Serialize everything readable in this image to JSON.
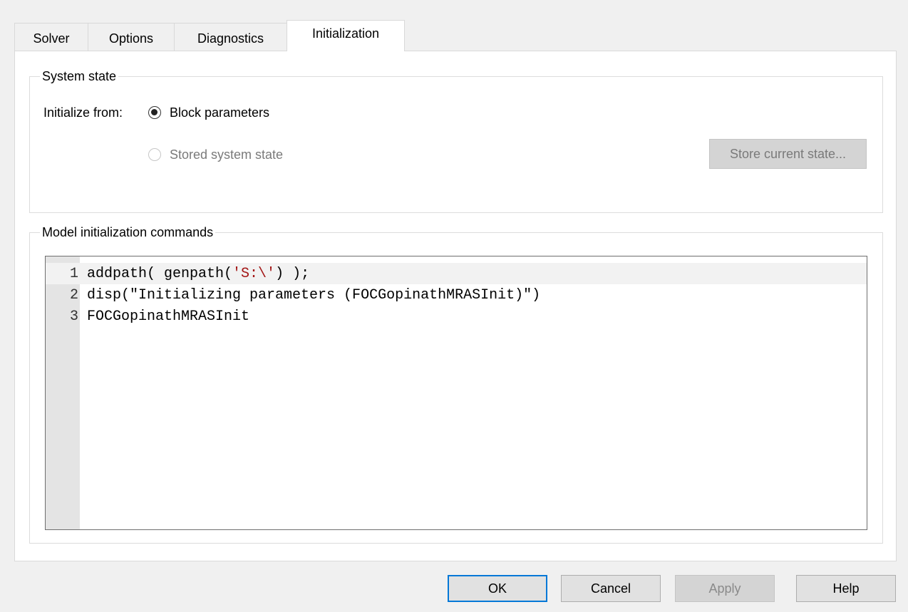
{
  "tabs": [
    {
      "label": "Solver",
      "active": false
    },
    {
      "label": "Options",
      "active": false
    },
    {
      "label": "Diagnostics",
      "active": false
    },
    {
      "label": "Initialization",
      "active": true
    }
  ],
  "system_state": {
    "legend": "System state",
    "initialize_from_label": "Initialize from:",
    "options": [
      {
        "label": "Block parameters",
        "selected": true,
        "enabled": true
      },
      {
        "label": "Stored system state",
        "selected": false,
        "enabled": false
      }
    ],
    "store_button_label": "Store current state..."
  },
  "commands": {
    "legend": "Model initialization commands",
    "lines": [
      {
        "num": "1",
        "pre": "addpath( genpath(",
        "str": "'S:\\'",
        "post": ") );"
      },
      {
        "num": "2",
        "pre": "disp(\"Initializing parameters (FOCGopinathMRASInit)\")",
        "str": "",
        "post": ""
      },
      {
        "num": "3",
        "pre": "FOCGopinathMRASInit",
        "str": "",
        "post": ""
      }
    ]
  },
  "buttons": {
    "ok": "OK",
    "cancel": "Cancel",
    "apply": "Apply",
    "help": "Help"
  },
  "colors": {
    "string_literal": "#a31515",
    "default_button_border": "#0078d7"
  }
}
